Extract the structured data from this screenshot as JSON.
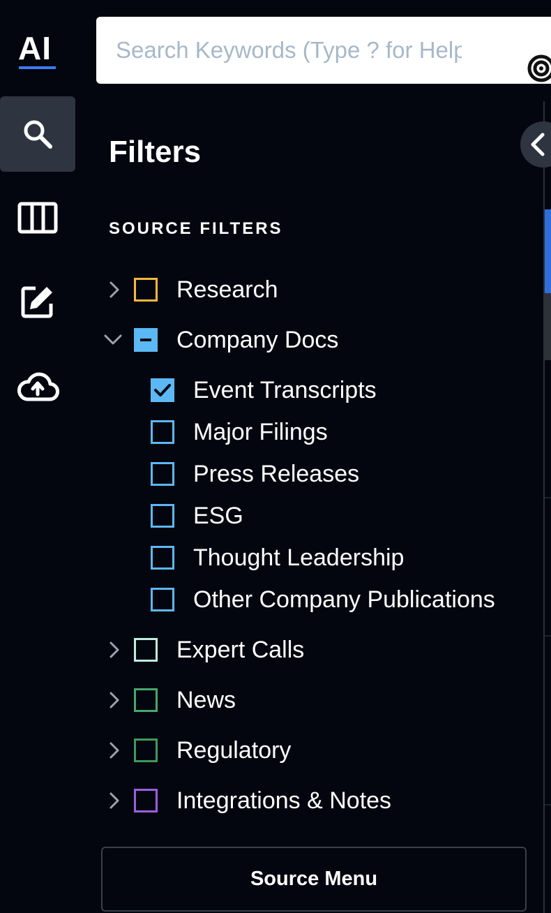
{
  "logo": {
    "text": "AI"
  },
  "search": {
    "placeholder": "Search Keywords (Type ? for Help)"
  },
  "rail": {
    "items": [
      {
        "icon": "search-icon",
        "active": true
      },
      {
        "icon": "columns-icon",
        "active": false
      },
      {
        "icon": "edit-icon",
        "active": false
      },
      {
        "icon": "cloud-upload-icon",
        "active": false
      }
    ]
  },
  "panel": {
    "title": "Filters",
    "section_label": "SOURCE FILTERS",
    "filters": [
      {
        "label": "Research",
        "color": "#f5b93d",
        "state": "unchecked",
        "expanded": false
      },
      {
        "label": "Company Docs",
        "color": "#5cb8f5",
        "state": "indeterminate",
        "expanded": true,
        "children": [
          {
            "label": "Event Transcripts",
            "state": "checked"
          },
          {
            "label": "Major Filings",
            "state": "unchecked"
          },
          {
            "label": "Press Releases",
            "state": "unchecked"
          },
          {
            "label": "ESG",
            "state": "unchecked"
          },
          {
            "label": "Thought Leadership",
            "state": "unchecked"
          },
          {
            "label": "Other Company Publications",
            "state": "unchecked"
          }
        ]
      },
      {
        "label": "Expert Calls",
        "color": "#bfeede",
        "state": "unchecked",
        "expanded": false
      },
      {
        "label": "News",
        "color": "#46a86c",
        "state": "unchecked",
        "expanded": false
      },
      {
        "label": "Regulatory",
        "color": "#3f9a5c",
        "state": "unchecked",
        "expanded": false
      },
      {
        "label": "Integrations & Notes",
        "color": "#9a5fe0",
        "state": "unchecked",
        "expanded": false
      }
    ],
    "source_menu_label": "Source Menu"
  },
  "colors": {
    "accent": "#3b7bf5",
    "background": "#04060f",
    "child_checkbox": "#5cb8f5"
  }
}
